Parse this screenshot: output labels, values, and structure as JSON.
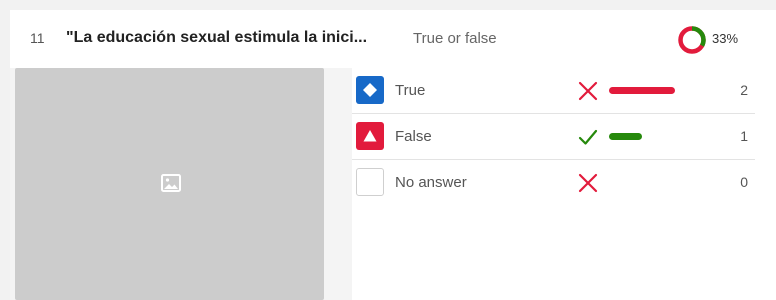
{
  "question": {
    "number": "11",
    "title": "\"La educación sexual estimula la inici...",
    "type": "True or false",
    "accuracy_percent_label": "33%",
    "accuracy_fraction": 0.33
  },
  "image_placeholder": {
    "icon": "image-icon"
  },
  "answers": [
    {
      "label": "True",
      "badge_icon": "diamond-icon",
      "badge_color": "#1769c8",
      "correct": false,
      "mark_icon": "cross-icon",
      "count": "2",
      "bar_fraction": 1.0,
      "bar_color": "#e21b3c"
    },
    {
      "label": "False",
      "badge_icon": "triangle-icon",
      "badge_color": "#e21b3c",
      "correct": true,
      "mark_icon": "check-icon",
      "count": "1",
      "bar_fraction": 0.5,
      "bar_color": "#26890c"
    },
    {
      "label": "No answer",
      "badge_icon": "",
      "badge_color": "#ffffff",
      "correct": false,
      "mark_icon": "cross-icon",
      "count": "0",
      "bar_fraction": 0,
      "bar_color": "#e21b3c"
    }
  ],
  "colors": {
    "correct": "#26890c",
    "incorrect": "#e21b3c",
    "donut_correct": "#26890c",
    "donut_incorrect": "#e21b3c"
  }
}
